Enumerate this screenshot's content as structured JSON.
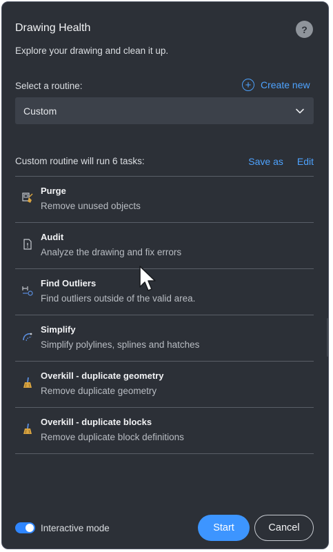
{
  "header": {
    "title": "Drawing Health",
    "help_label": "?",
    "subtitle": "Explore your drawing and clean it up."
  },
  "routine": {
    "label": "Select a routine:",
    "create_new_label": "Create new",
    "create_new_icon": "plus-circle-icon",
    "selected": "Custom"
  },
  "tasks_header": {
    "label": "Custom routine will run 6 tasks:",
    "save_as_label": "Save as",
    "edit_label": "Edit"
  },
  "tasks": [
    {
      "name": "Purge",
      "description": "Remove unused objects",
      "icon": "purge-icon"
    },
    {
      "name": "Audit",
      "description": "Analyze the drawing and fix errors",
      "icon": "audit-document-icon"
    },
    {
      "name": "Find Outliers",
      "description": "Find outliers outside of the valid area.",
      "icon": "outliers-icon"
    },
    {
      "name": "Simplify",
      "description": "Simplify polylines, splines and hatches",
      "icon": "simplify-curve-icon"
    },
    {
      "name": "Overkill - duplicate geometry",
      "description": "Remove duplicate geometry",
      "icon": "broom-icon"
    },
    {
      "name": "Overkill - duplicate blocks",
      "description": "Remove duplicate block definitions",
      "icon": "broom-icon"
    }
  ],
  "footer": {
    "interactive_mode_label": "Interactive mode",
    "interactive_mode_on": true,
    "start_label": "Start",
    "cancel_label": "Cancel"
  },
  "colors": {
    "panel_bg": "#2c3037",
    "accent": "#3d95ff",
    "link": "#4ea3ff",
    "icon_gold": "#d9a441",
    "icon_blue": "#5b8fe0"
  }
}
